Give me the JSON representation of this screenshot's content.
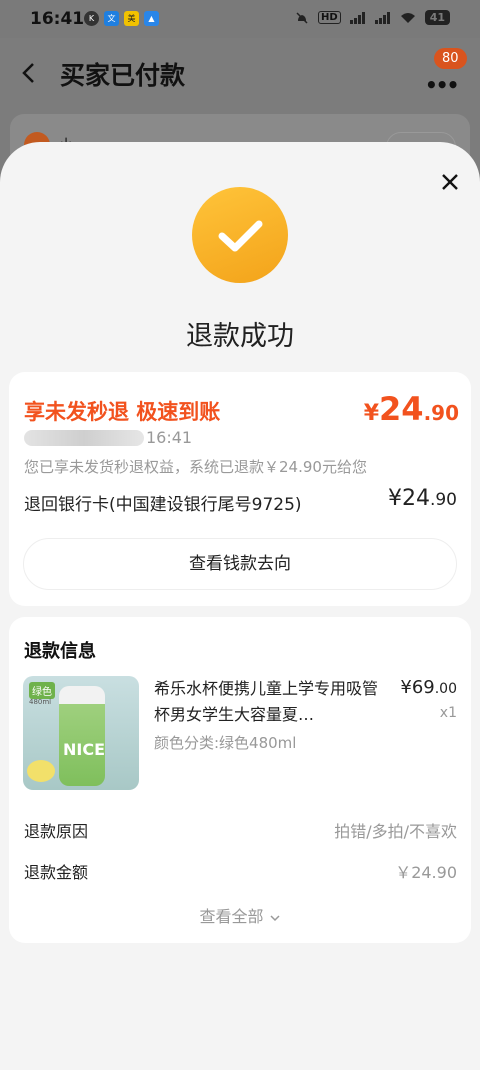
{
  "status_bar": {
    "time": "16:41",
    "network": "4G 5G",
    "hd": "HD",
    "battery": "41"
  },
  "background_page": {
    "title": "买家已付款",
    "more_badge": "80",
    "buyer_name": "小..."
  },
  "sheet": {
    "title": "退款成功",
    "refund_card": {
      "headline": "享未发秒退 极速到账",
      "price_yen": "¥",
      "price_int": "24",
      "price_dec": ".90",
      "time": "16:41",
      "description": "您已享未发货秒退权益，系统已退款￥24.90元给您",
      "bank_label": "退回银行卡(中国建设银行尾号9725)",
      "bank_amount_int": "¥24",
      "bank_amount_dec": ".90",
      "track_button": "查看钱款去向"
    },
    "refund_info": {
      "title": "退款信息",
      "product": {
        "name": "希乐水杯便携儿童上学专用吸管杯男女学生大容量夏…",
        "price_int": "¥69",
        "price_dec": ".00",
        "quantity": "x1",
        "spec": "颜色分类:绿色480ml",
        "thumb_tag": "绿色",
        "thumb_sub": "480ml",
        "thumb_text": "NICE"
      },
      "rows": [
        {
          "label": "退款原因",
          "value": "拍错/多拍/不喜欢"
        },
        {
          "label": "退款金额",
          "value": "￥24.90"
        }
      ],
      "view_all": "查看全部"
    }
  },
  "colors": {
    "accent_orange": "#f2521e",
    "success_yellow": "#f5a81f",
    "badge_orange": "#d9541e"
  }
}
